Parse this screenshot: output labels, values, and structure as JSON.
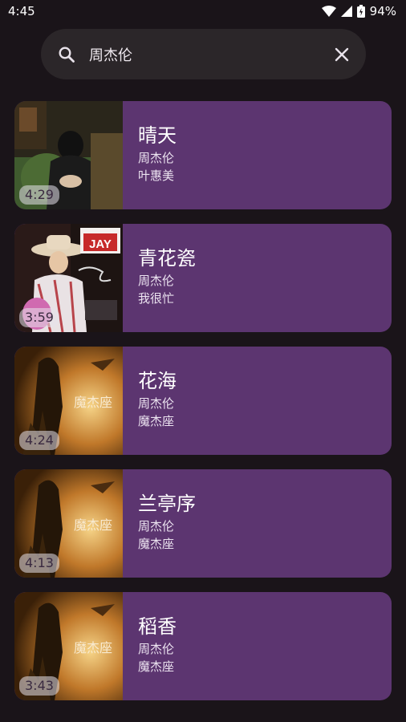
{
  "status_bar": {
    "time": "4:45",
    "battery": "94%"
  },
  "search": {
    "query": "周杰伦",
    "placeholder": ""
  },
  "songs": [
    {
      "title": "晴天",
      "artist": "周杰伦",
      "album": "叶惠美",
      "duration": "4:29",
      "cover": "cover-yehuimei"
    },
    {
      "title": "青花瓷",
      "artist": "周杰伦",
      "album": "我很忙",
      "duration": "3:59",
      "cover": "cover-wohenmang"
    },
    {
      "title": "花海",
      "artist": "周杰伦",
      "album": "魔杰座",
      "duration": "4:24",
      "cover": "cover-mojiezuo"
    },
    {
      "title": "兰亭序",
      "artist": "周杰伦",
      "album": "魔杰座",
      "duration": "4:13",
      "cover": "cover-mojiezuo"
    },
    {
      "title": "稻香",
      "artist": "周杰伦",
      "album": "魔杰座",
      "duration": "3:43",
      "cover": "cover-mojiezuo"
    }
  ],
  "colors": {
    "background": "#1a1419",
    "card": "#5c3570",
    "search_bg": "#2b2629"
  }
}
